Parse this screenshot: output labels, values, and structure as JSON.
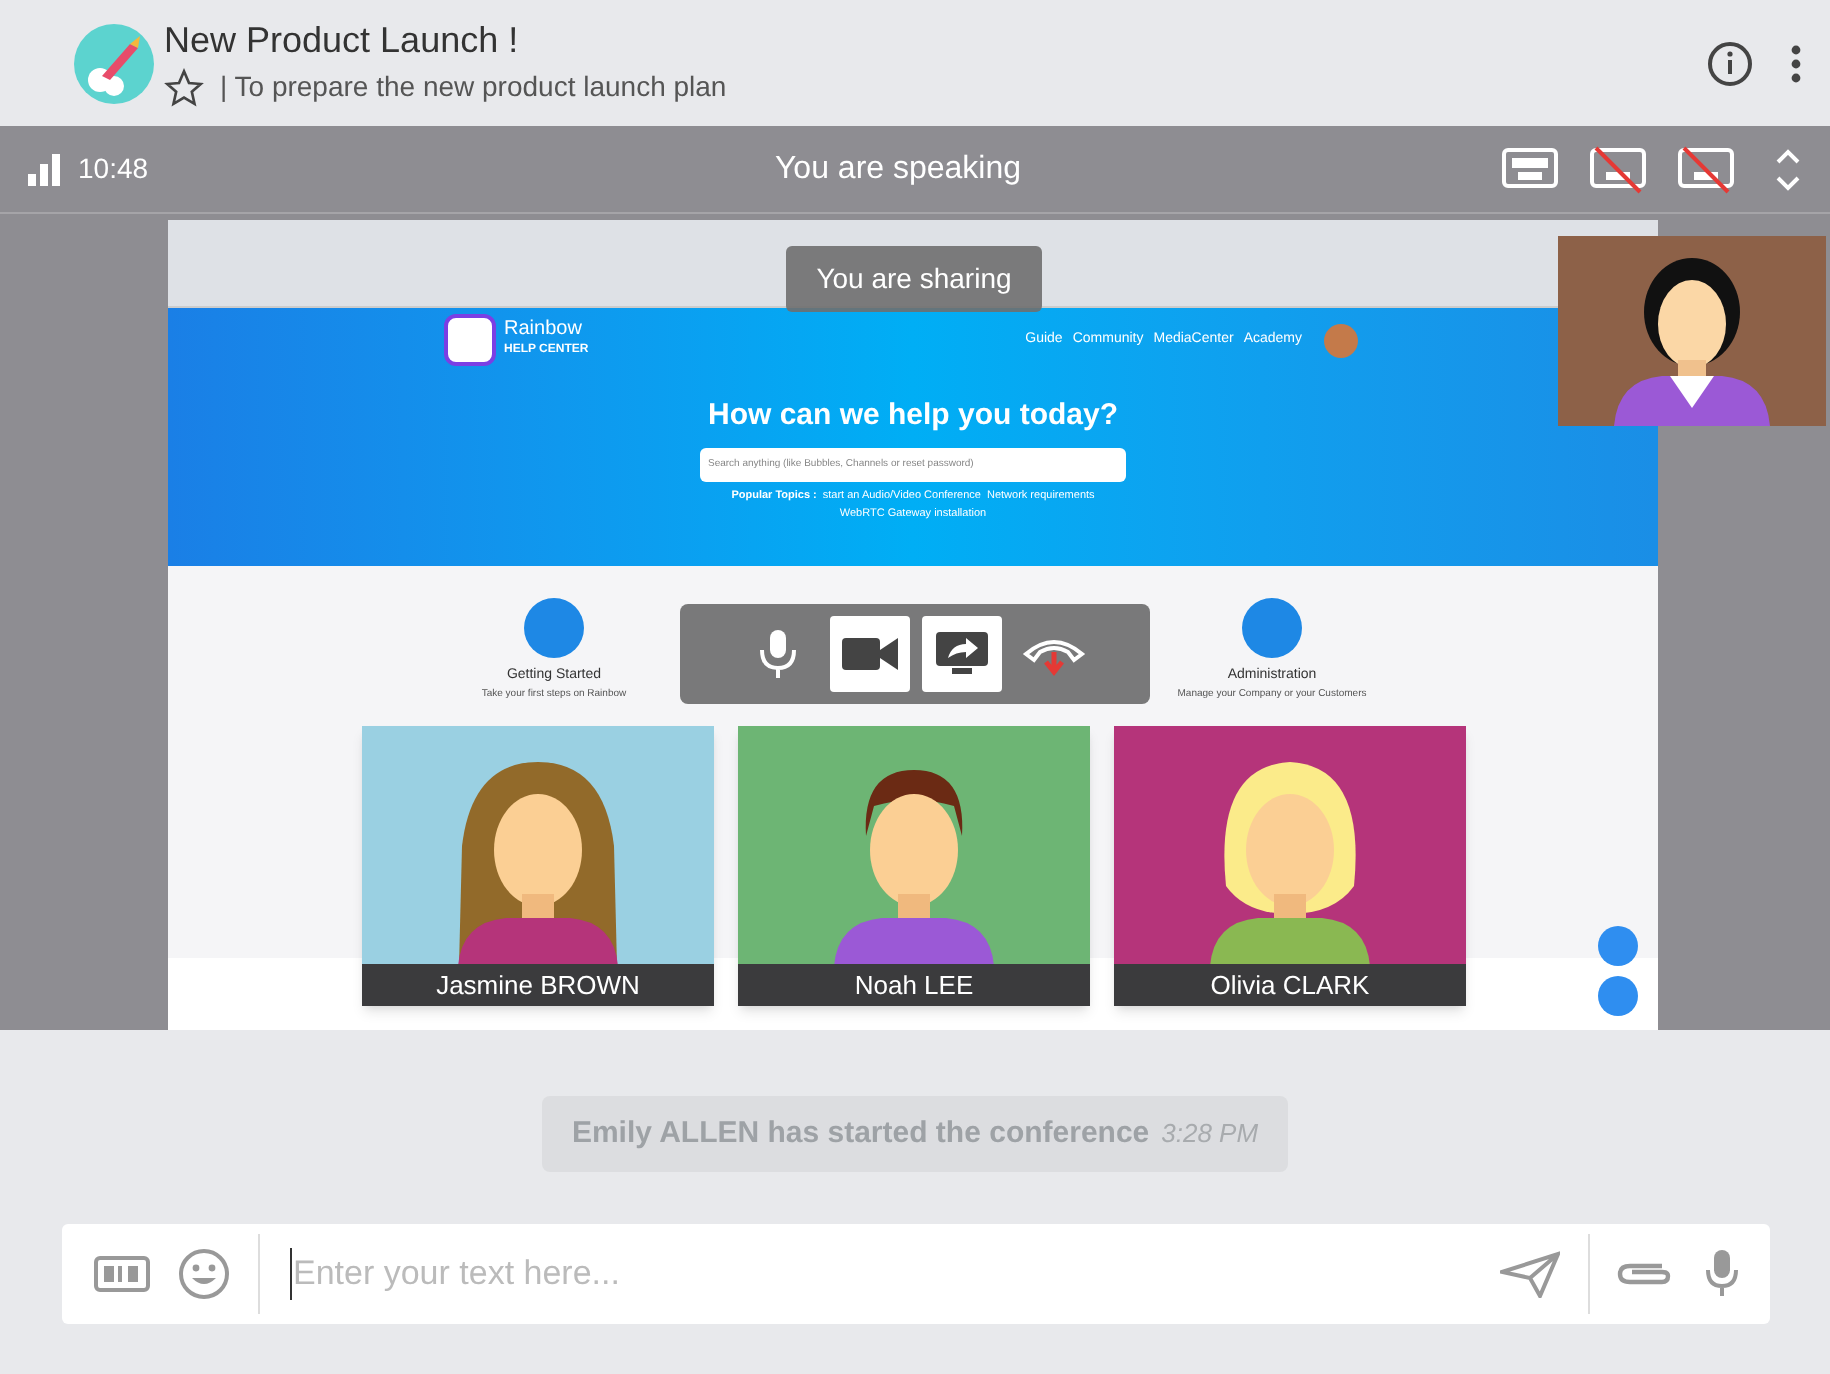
{
  "conversation": {
    "title": "New Product Launch !",
    "subtitle": "| To prepare the new product launch plan",
    "starred": false
  },
  "call_bar": {
    "time": "10:48",
    "status": "You are speaking",
    "layouts": [
      {
        "disabled": false
      },
      {
        "disabled": true
      },
      {
        "disabled": true
      }
    ]
  },
  "shared_screen": {
    "banner": "You are sharing",
    "brand": "Rainbow",
    "brand_sub": "HELP CENTER",
    "nav": [
      "Guide",
      "Community",
      "MediaCenter",
      "Academy"
    ],
    "headline": "How can we help you today?",
    "search_placeholder": "Search anything (like Bubbles, Channels or reset password)",
    "popular_label": "Popular Topics :",
    "popular_links": [
      "start an Audio/Video Conference",
      "Network requirements",
      "WebRTC Gateway installation"
    ],
    "categories": [
      {
        "title": "Getting Started",
        "desc": "Take your first steps on Rainbow"
      },
      {
        "title": "Administration",
        "desc": "Manage your Company or your Customers"
      }
    ]
  },
  "call_controls": [
    {
      "kind": "mic",
      "active": false
    },
    {
      "kind": "camera",
      "active": true
    },
    {
      "kind": "share",
      "active": true
    },
    {
      "kind": "hangup",
      "active": false
    }
  ],
  "participants": [
    {
      "name": "Jasmine BROWN",
      "color": "#9ad0e2",
      "kind": "long"
    },
    {
      "name": "Noah LEE",
      "color": "#6db574",
      "kind": "short"
    },
    {
      "name": "Olivia CLARK",
      "color": "#b5347a",
      "kind": "bob"
    }
  ],
  "message": {
    "text": "Emily ALLEN has started the conference",
    "time": "3:28 PM"
  },
  "composer": {
    "placeholder": "Enter your text here..."
  }
}
